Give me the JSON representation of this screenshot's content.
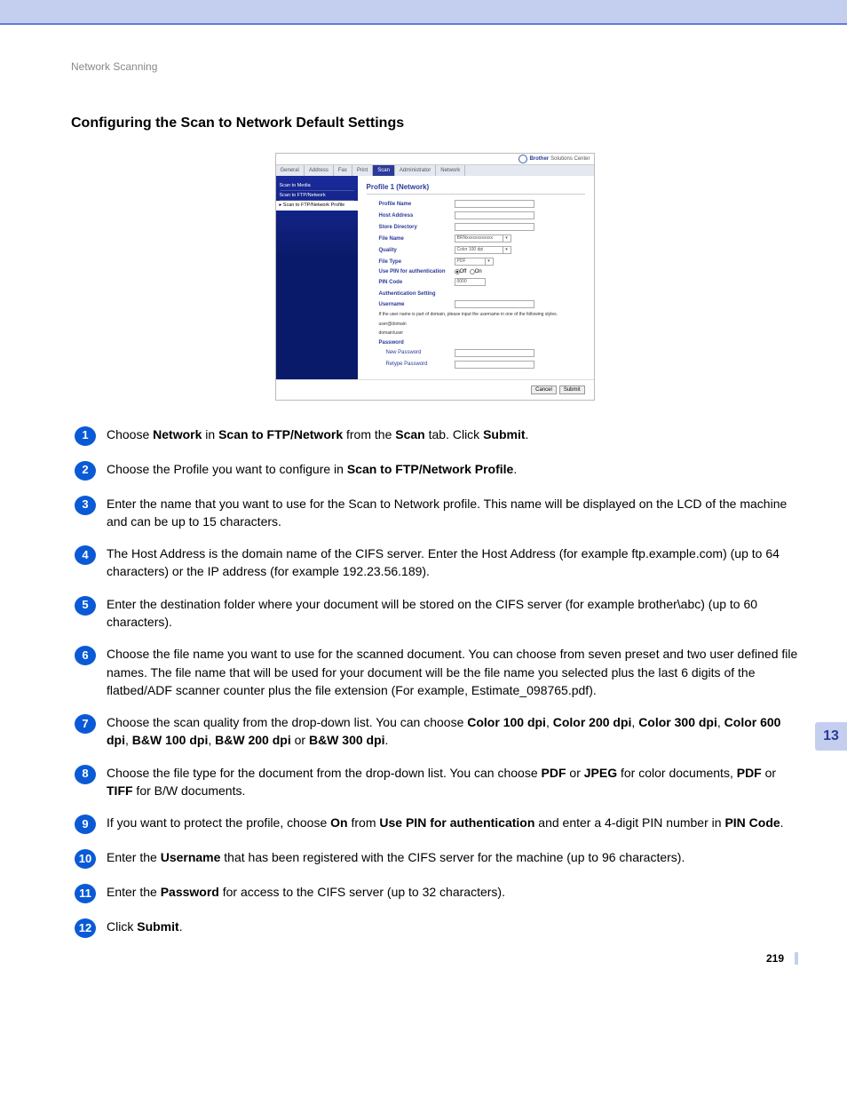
{
  "breadcrumb": "Network Scanning",
  "section_title": "Configuring the Scan to Network Default Settings",
  "side_tab": "13",
  "page_number": "219",
  "screenshot": {
    "brand": "Brother",
    "brand_sub": "Solutions Center",
    "tabs": [
      "General",
      "Address",
      "Fax",
      "Print",
      "Scan",
      "Administrator",
      "Network"
    ],
    "active_tab_index": 4,
    "sidebar": {
      "items": [
        "Scan to Media",
        "Scan to FTP/Network",
        "▸ Scan to FTP/Network Profile"
      ],
      "active_index": 2
    },
    "panel_title": "Profile 1 (Network)",
    "fields": {
      "profile_name": "Profile Name",
      "host_address": "Host Address",
      "store_directory": "Store Directory",
      "file_name": "File Name",
      "file_name_value": "BRNxxxxxxxxxxxx",
      "quality": "Quality",
      "quality_value": "Color 100 dpi",
      "file_type": "File Type",
      "file_type_value": "PDF",
      "use_pin": "Use PIN for authentication",
      "off": "Off",
      "on": "On",
      "pin_code": "PIN Code",
      "pin_code_value": "0000",
      "auth_setting": "Authentication Setting",
      "username": "Username",
      "note_line1": "If the user name is part of domain, please input the username in one of the following styles.",
      "note_line2": "user@domain",
      "note_line3": "domain\\user",
      "password": "Password",
      "new_password": "New Password",
      "retype_password": "Retype Password"
    },
    "buttons": {
      "cancel": "Cancel",
      "submit": "Submit"
    }
  },
  "steps": [
    {
      "n": "1",
      "plain1": "Choose ",
      "b1": "Network",
      "plain2": " in ",
      "b2": "Scan to FTP/Network",
      "plain3": " from the ",
      "b3": "Scan",
      "plain4": " tab. Click ",
      "b4": "Submit",
      "plain5": "."
    },
    {
      "n": "2",
      "plain1": "Choose the Profile you want to configure in ",
      "b1": "Scan to FTP/Network Profile",
      "plain2": "."
    },
    {
      "n": "3",
      "plain1": "Enter the name that you want to use for the Scan to Network profile. This name will be displayed on the LCD of the machine and can be up to 15 characters."
    },
    {
      "n": "4",
      "plain1": "The Host Address is the domain name of the CIFS server. Enter the Host Address (for example ftp.example.com) (up to 64 characters) or the IP address (for example 192.23.56.189)."
    },
    {
      "n": "5",
      "plain1": "Enter the destination folder where your document will be stored on the CIFS server (for example brother\\abc) (up to 60 characters)."
    },
    {
      "n": "6",
      "plain1": "Choose the file name you want to use for the scanned document. You can choose from seven preset and two user defined file names. The file name that will be used for your document will be the file name you selected plus the last 6 digits of the flatbed/ADF scanner counter plus the file extension (For example, Estimate_098765.pdf)."
    },
    {
      "n": "7",
      "plain1": "Choose the scan quality from the drop-down list. You can choose ",
      "b1": "Color 100 dpi",
      "plain2": ", ",
      "b2": "Color 200 dpi",
      "plain3": ", ",
      "b3": "Color 300 dpi",
      "plain4": ", ",
      "b4": "Color 600 dpi",
      "plain5": ", ",
      "b5": "B&W 100 dpi",
      "plain6": ", ",
      "b6": "B&W 200 dpi",
      "plain7": " or ",
      "b7": "B&W 300 dpi",
      "plain8": "."
    },
    {
      "n": "8",
      "plain1": "Choose the file type for the document from the drop-down list. You can choose ",
      "b1": "PDF",
      "plain2": " or ",
      "b2": "JPEG",
      "plain3": " for color documents, ",
      "b3": "PDF",
      "plain4": " or ",
      "b4": "TIFF",
      "plain5": " for B/W documents."
    },
    {
      "n": "9",
      "plain1": "If you want to protect the profile, choose ",
      "b1": "On",
      "plain2": " from ",
      "b2": "Use PIN for authentication",
      "plain3": " and enter a 4-digit PIN number in ",
      "b3": "PIN Code",
      "plain4": "."
    },
    {
      "n": "10",
      "plain1": "Enter the ",
      "b1": "Username",
      "plain2": " that has been registered with the CIFS server for the machine (up to 96 characters)."
    },
    {
      "n": "11",
      "plain1": "Enter the ",
      "b1": "Password",
      "plain2": " for access to the CIFS server (up to 32 characters)."
    },
    {
      "n": "12",
      "plain1": "Click ",
      "b1": "Submit",
      "plain2": "."
    }
  ]
}
